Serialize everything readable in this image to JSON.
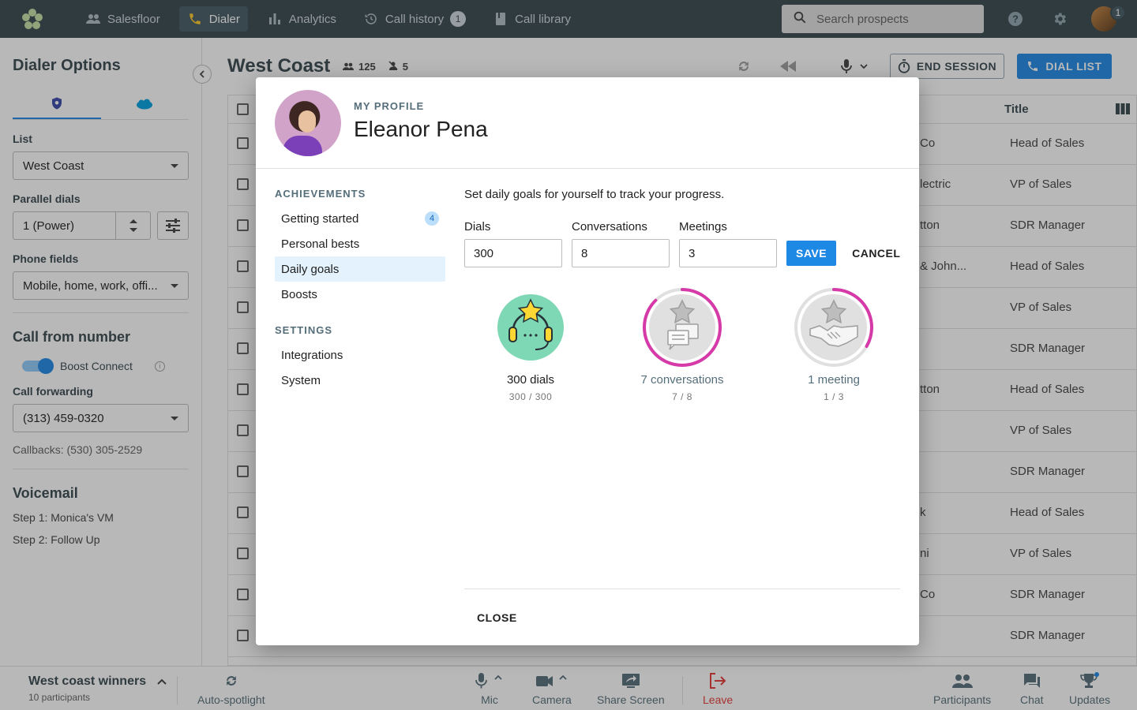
{
  "topnav": {
    "items": [
      {
        "label": "Salesfloor",
        "icon": "people-icon"
      },
      {
        "label": "Dialer",
        "icon": "phone-icon"
      },
      {
        "label": "Analytics",
        "icon": "bar-chart-icon"
      },
      {
        "label": "Call history",
        "icon": "history-icon",
        "badge": "1"
      },
      {
        "label": "Call library",
        "icon": "book-icon"
      }
    ],
    "search_placeholder": "Search prospects",
    "avatar_badge": "1"
  },
  "sidebar": {
    "title": "Dialer Options",
    "list_label": "List",
    "list_value": "West Coast",
    "parallel_label": "Parallel dials",
    "parallel_value": "1 (Power)",
    "phone_fields_label": "Phone fields",
    "phone_fields_value": "Mobile, home, work, offi...",
    "call_from_title": "Call from number",
    "boost_connect_label": "Boost Connect",
    "call_forwarding_label": "Call forwarding",
    "call_forwarding_value": "(313) 459-0320",
    "callbacks_text": "Callbacks: (530) 305-2529",
    "voicemail_title": "Voicemail",
    "vm_steps": [
      "Step 1: Monica's VM",
      "Step 2: Follow Up"
    ]
  },
  "main": {
    "title": "West Coast",
    "count_people": "125",
    "count_excluded": "5",
    "end_session_label": "END SESSION",
    "dial_list_label": "DIAL LIST",
    "title_header": "Title",
    "rows": [
      {
        "company": "Co",
        "title": "Head of Sales"
      },
      {
        "company": "lectric",
        "title": "VP of Sales"
      },
      {
        "company": "tton",
        "title": "SDR Manager"
      },
      {
        "company": "& John...",
        "title": "Head of Sales"
      },
      {
        "company": "",
        "title": "VP of Sales"
      },
      {
        "company": "",
        "title": "SDR Manager"
      },
      {
        "company": "tton",
        "title": "Head of Sales"
      },
      {
        "company": "",
        "title": "VP of Sales"
      },
      {
        "company": "",
        "title": "SDR Manager"
      },
      {
        "company": "k",
        "title": "Head of Sales"
      },
      {
        "company": "ni",
        "title": "VP of Sales"
      },
      {
        "company": "Co",
        "title": "SDR Manager"
      },
      {
        "company": "",
        "title": "SDR Manager"
      }
    ]
  },
  "bottombar": {
    "room_name": "West coast winners",
    "room_sub": "10 participants",
    "auto_spotlight": "Auto-spotlight",
    "mic": "Mic",
    "camera": "Camera",
    "share_screen": "Share Screen",
    "leave": "Leave",
    "participants": "Participants",
    "chat": "Chat",
    "updates": "Updates"
  },
  "modal": {
    "eyebrow": "MY PROFILE",
    "name": "Eleanor Pena",
    "achievements_label": "ACHIEVEMENTS",
    "nav_achievements": [
      {
        "label": "Getting started",
        "badge": "4"
      },
      {
        "label": "Personal bests"
      },
      {
        "label": "Daily goals"
      },
      {
        "label": "Boosts"
      }
    ],
    "settings_label": "SETTINGS",
    "nav_settings": [
      {
        "label": "Integrations"
      },
      {
        "label": "System"
      }
    ],
    "description": "Set daily goals for yourself to track your progress.",
    "fields": {
      "dials_label": "Dials",
      "dials_value": "300",
      "conversations_label": "Conversations",
      "conversations_value": "8",
      "meetings_label": "Meetings",
      "meetings_value": "3"
    },
    "save_label": "SAVE",
    "cancel_label": "CANCEL",
    "goals": [
      {
        "label": "300 dials",
        "progress_text": "300 / 300",
        "progress": 1.0,
        "icon": "headset-star-icon"
      },
      {
        "label": "7 conversations",
        "progress_text": "7 / 8",
        "progress": 0.875,
        "icon": "chat-star-icon"
      },
      {
        "label": "1 meeting",
        "progress_text": "1 / 3",
        "progress": 0.333,
        "icon": "handshake-star-icon"
      }
    ],
    "close_label": "CLOSE"
  },
  "colors": {
    "nav_bg": "#37474f",
    "accent": "#1e88e5",
    "goal_complete": "#7fd8b5",
    "progress_ring": "#d63aa8"
  }
}
